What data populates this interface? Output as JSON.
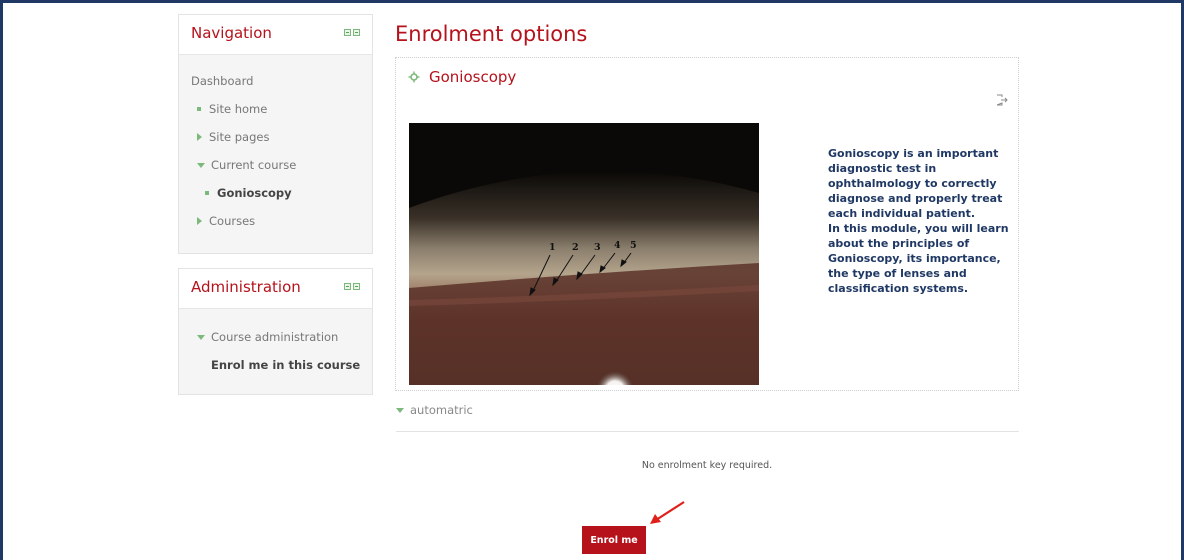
{
  "navigation": {
    "title": "Navigation",
    "items": [
      {
        "label": "Dashboard"
      },
      {
        "label": "Site home"
      },
      {
        "label": "Site pages"
      },
      {
        "label": "Current course"
      },
      {
        "label": "Gonioscopy"
      },
      {
        "label": "Courses"
      }
    ]
  },
  "administration": {
    "title": "Administration",
    "items": [
      {
        "label": "Course administration"
      },
      {
        "label": "Enrol me in this course"
      }
    ]
  },
  "main": {
    "page_title": "Enrolment options",
    "course": {
      "name": "Gonioscopy",
      "image_labels": [
        "1",
        "2",
        "3",
        "4",
        "5"
      ],
      "summary_1": "Gonioscopy is an important diagnostic test in ophthalmology to correctly diagnose and properly treat each individual patient.",
      "summary_2": "In this module, you will learn about the principles of Gonioscopy, its importance, the type of lenses and classification systems."
    },
    "section_label": "automatric",
    "key_text": "No enrolment key required.",
    "enrol_button": "Enrol me"
  },
  "colors": {
    "accent": "#b5121b",
    "summary_text": "#1f3864",
    "icon_green": "#7cba7c"
  }
}
